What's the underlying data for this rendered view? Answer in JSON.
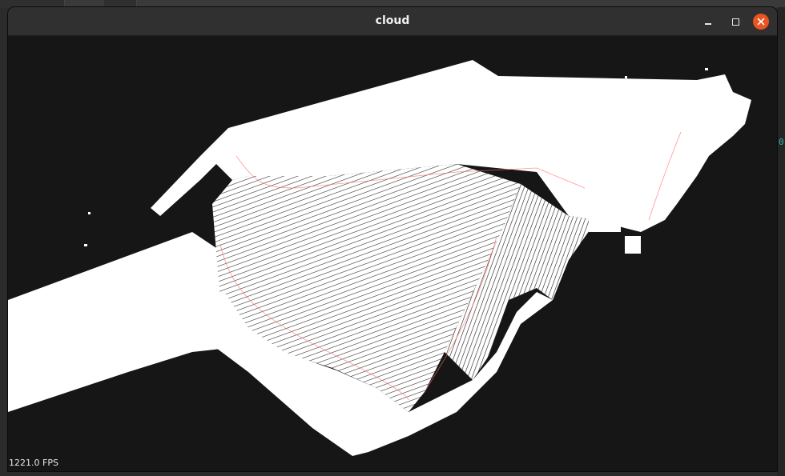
{
  "window": {
    "title": "cloud",
    "close_color": "#e95420"
  },
  "viewer": {
    "fps_label": "1221.0 FPS",
    "background_color": "#161616",
    "point_color": "#ffffff",
    "accent_point_color": "#ff5a5a"
  },
  "side_glyph": "0",
  "icons": {
    "minimize": "minimize-icon",
    "maximize": "maximize-icon",
    "close": "close-icon"
  }
}
